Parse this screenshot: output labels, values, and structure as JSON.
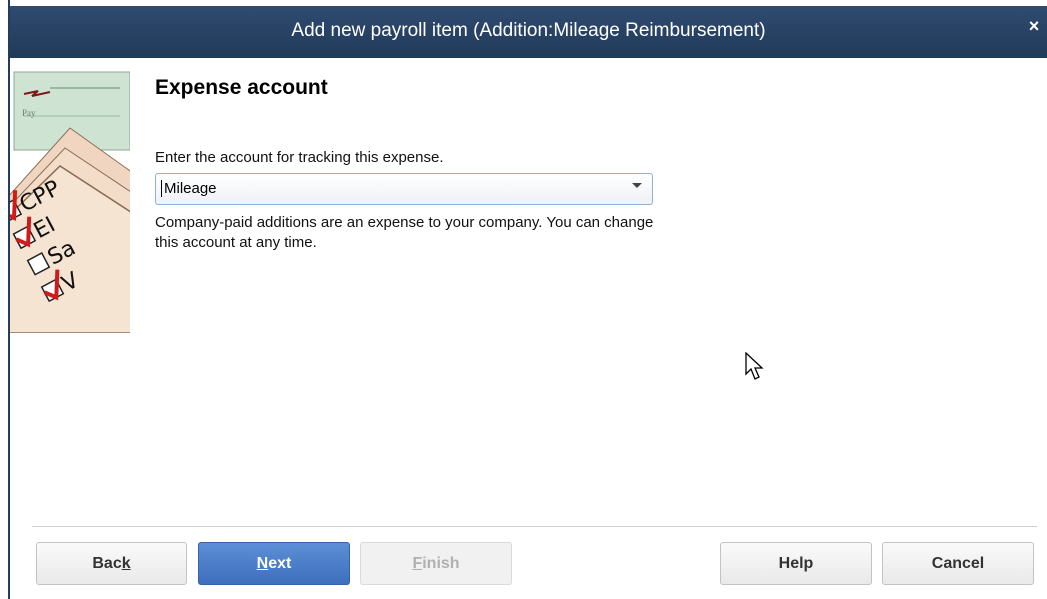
{
  "window": {
    "title": "Add new payroll item (Addition:Mileage Reimbursement)",
    "close_label": "×"
  },
  "illustration": {
    "checklist": [
      "CPP",
      "EI",
      "Sa",
      "V"
    ]
  },
  "main": {
    "heading": "Expense account",
    "prompt": "Enter the account for tracking this expense.",
    "account_select": {
      "value": "Mileage"
    },
    "description_line1": "Company-paid additions are an expense to your company. You can change",
    "description_line2": "this account at any time."
  },
  "buttons": {
    "back": {
      "pre": "Bac",
      "key": "k",
      "post": ""
    },
    "next": {
      "pre": "",
      "key": "N",
      "post": "ext"
    },
    "finish": {
      "pre": "",
      "key": "F",
      "post": "inish"
    },
    "help": "Help",
    "cancel": "Cancel"
  },
  "colors": {
    "titlebar": "#2a4466",
    "primary_button": "#4a7ec8"
  }
}
